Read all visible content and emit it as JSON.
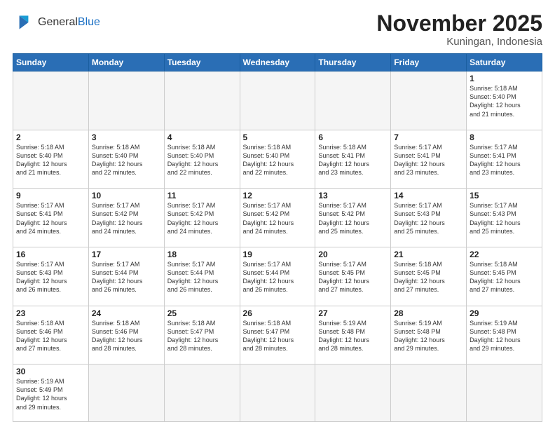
{
  "logo": {
    "general": "General",
    "blue": "Blue"
  },
  "title": "November 2025",
  "location": "Kuningan, Indonesia",
  "days_header": [
    "Sunday",
    "Monday",
    "Tuesday",
    "Wednesday",
    "Thursday",
    "Friday",
    "Saturday"
  ],
  "weeks": [
    [
      {
        "num": "",
        "info": "",
        "empty": true
      },
      {
        "num": "",
        "info": "",
        "empty": true
      },
      {
        "num": "",
        "info": "",
        "empty": true
      },
      {
        "num": "",
        "info": "",
        "empty": true
      },
      {
        "num": "",
        "info": "",
        "empty": true
      },
      {
        "num": "",
        "info": "",
        "empty": true
      },
      {
        "num": "1",
        "info": "Sunrise: 5:18 AM\nSunset: 5:40 PM\nDaylight: 12 hours\nand 21 minutes."
      }
    ],
    [
      {
        "num": "2",
        "info": "Sunrise: 5:18 AM\nSunset: 5:40 PM\nDaylight: 12 hours\nand 21 minutes."
      },
      {
        "num": "3",
        "info": "Sunrise: 5:18 AM\nSunset: 5:40 PM\nDaylight: 12 hours\nand 22 minutes."
      },
      {
        "num": "4",
        "info": "Sunrise: 5:18 AM\nSunset: 5:40 PM\nDaylight: 12 hours\nand 22 minutes."
      },
      {
        "num": "5",
        "info": "Sunrise: 5:18 AM\nSunset: 5:40 PM\nDaylight: 12 hours\nand 22 minutes."
      },
      {
        "num": "6",
        "info": "Sunrise: 5:18 AM\nSunset: 5:41 PM\nDaylight: 12 hours\nand 23 minutes."
      },
      {
        "num": "7",
        "info": "Sunrise: 5:17 AM\nSunset: 5:41 PM\nDaylight: 12 hours\nand 23 minutes."
      },
      {
        "num": "8",
        "info": "Sunrise: 5:17 AM\nSunset: 5:41 PM\nDaylight: 12 hours\nand 23 minutes."
      }
    ],
    [
      {
        "num": "9",
        "info": "Sunrise: 5:17 AM\nSunset: 5:41 PM\nDaylight: 12 hours\nand 24 minutes."
      },
      {
        "num": "10",
        "info": "Sunrise: 5:17 AM\nSunset: 5:42 PM\nDaylight: 12 hours\nand 24 minutes."
      },
      {
        "num": "11",
        "info": "Sunrise: 5:17 AM\nSunset: 5:42 PM\nDaylight: 12 hours\nand 24 minutes."
      },
      {
        "num": "12",
        "info": "Sunrise: 5:17 AM\nSunset: 5:42 PM\nDaylight: 12 hours\nand 24 minutes."
      },
      {
        "num": "13",
        "info": "Sunrise: 5:17 AM\nSunset: 5:42 PM\nDaylight: 12 hours\nand 25 minutes."
      },
      {
        "num": "14",
        "info": "Sunrise: 5:17 AM\nSunset: 5:43 PM\nDaylight: 12 hours\nand 25 minutes."
      },
      {
        "num": "15",
        "info": "Sunrise: 5:17 AM\nSunset: 5:43 PM\nDaylight: 12 hours\nand 25 minutes."
      }
    ],
    [
      {
        "num": "16",
        "info": "Sunrise: 5:17 AM\nSunset: 5:43 PM\nDaylight: 12 hours\nand 26 minutes."
      },
      {
        "num": "17",
        "info": "Sunrise: 5:17 AM\nSunset: 5:44 PM\nDaylight: 12 hours\nand 26 minutes."
      },
      {
        "num": "18",
        "info": "Sunrise: 5:17 AM\nSunset: 5:44 PM\nDaylight: 12 hours\nand 26 minutes."
      },
      {
        "num": "19",
        "info": "Sunrise: 5:17 AM\nSunset: 5:44 PM\nDaylight: 12 hours\nand 26 minutes."
      },
      {
        "num": "20",
        "info": "Sunrise: 5:17 AM\nSunset: 5:45 PM\nDaylight: 12 hours\nand 27 minutes."
      },
      {
        "num": "21",
        "info": "Sunrise: 5:18 AM\nSunset: 5:45 PM\nDaylight: 12 hours\nand 27 minutes."
      },
      {
        "num": "22",
        "info": "Sunrise: 5:18 AM\nSunset: 5:45 PM\nDaylight: 12 hours\nand 27 minutes."
      }
    ],
    [
      {
        "num": "23",
        "info": "Sunrise: 5:18 AM\nSunset: 5:46 PM\nDaylight: 12 hours\nand 27 minutes."
      },
      {
        "num": "24",
        "info": "Sunrise: 5:18 AM\nSunset: 5:46 PM\nDaylight: 12 hours\nand 28 minutes."
      },
      {
        "num": "25",
        "info": "Sunrise: 5:18 AM\nSunset: 5:47 PM\nDaylight: 12 hours\nand 28 minutes."
      },
      {
        "num": "26",
        "info": "Sunrise: 5:18 AM\nSunset: 5:47 PM\nDaylight: 12 hours\nand 28 minutes."
      },
      {
        "num": "27",
        "info": "Sunrise: 5:19 AM\nSunset: 5:48 PM\nDaylight: 12 hours\nand 28 minutes."
      },
      {
        "num": "28",
        "info": "Sunrise: 5:19 AM\nSunset: 5:48 PM\nDaylight: 12 hours\nand 29 minutes."
      },
      {
        "num": "29",
        "info": "Sunrise: 5:19 AM\nSunset: 5:48 PM\nDaylight: 12 hours\nand 29 minutes."
      }
    ],
    [
      {
        "num": "30",
        "info": "Sunrise: 5:19 AM\nSunset: 5:49 PM\nDaylight: 12 hours\nand 29 minutes."
      },
      {
        "num": "",
        "info": "",
        "empty": true
      },
      {
        "num": "",
        "info": "",
        "empty": true
      },
      {
        "num": "",
        "info": "",
        "empty": true
      },
      {
        "num": "",
        "info": "",
        "empty": true
      },
      {
        "num": "",
        "info": "",
        "empty": true
      },
      {
        "num": "",
        "info": "",
        "empty": true
      }
    ]
  ]
}
